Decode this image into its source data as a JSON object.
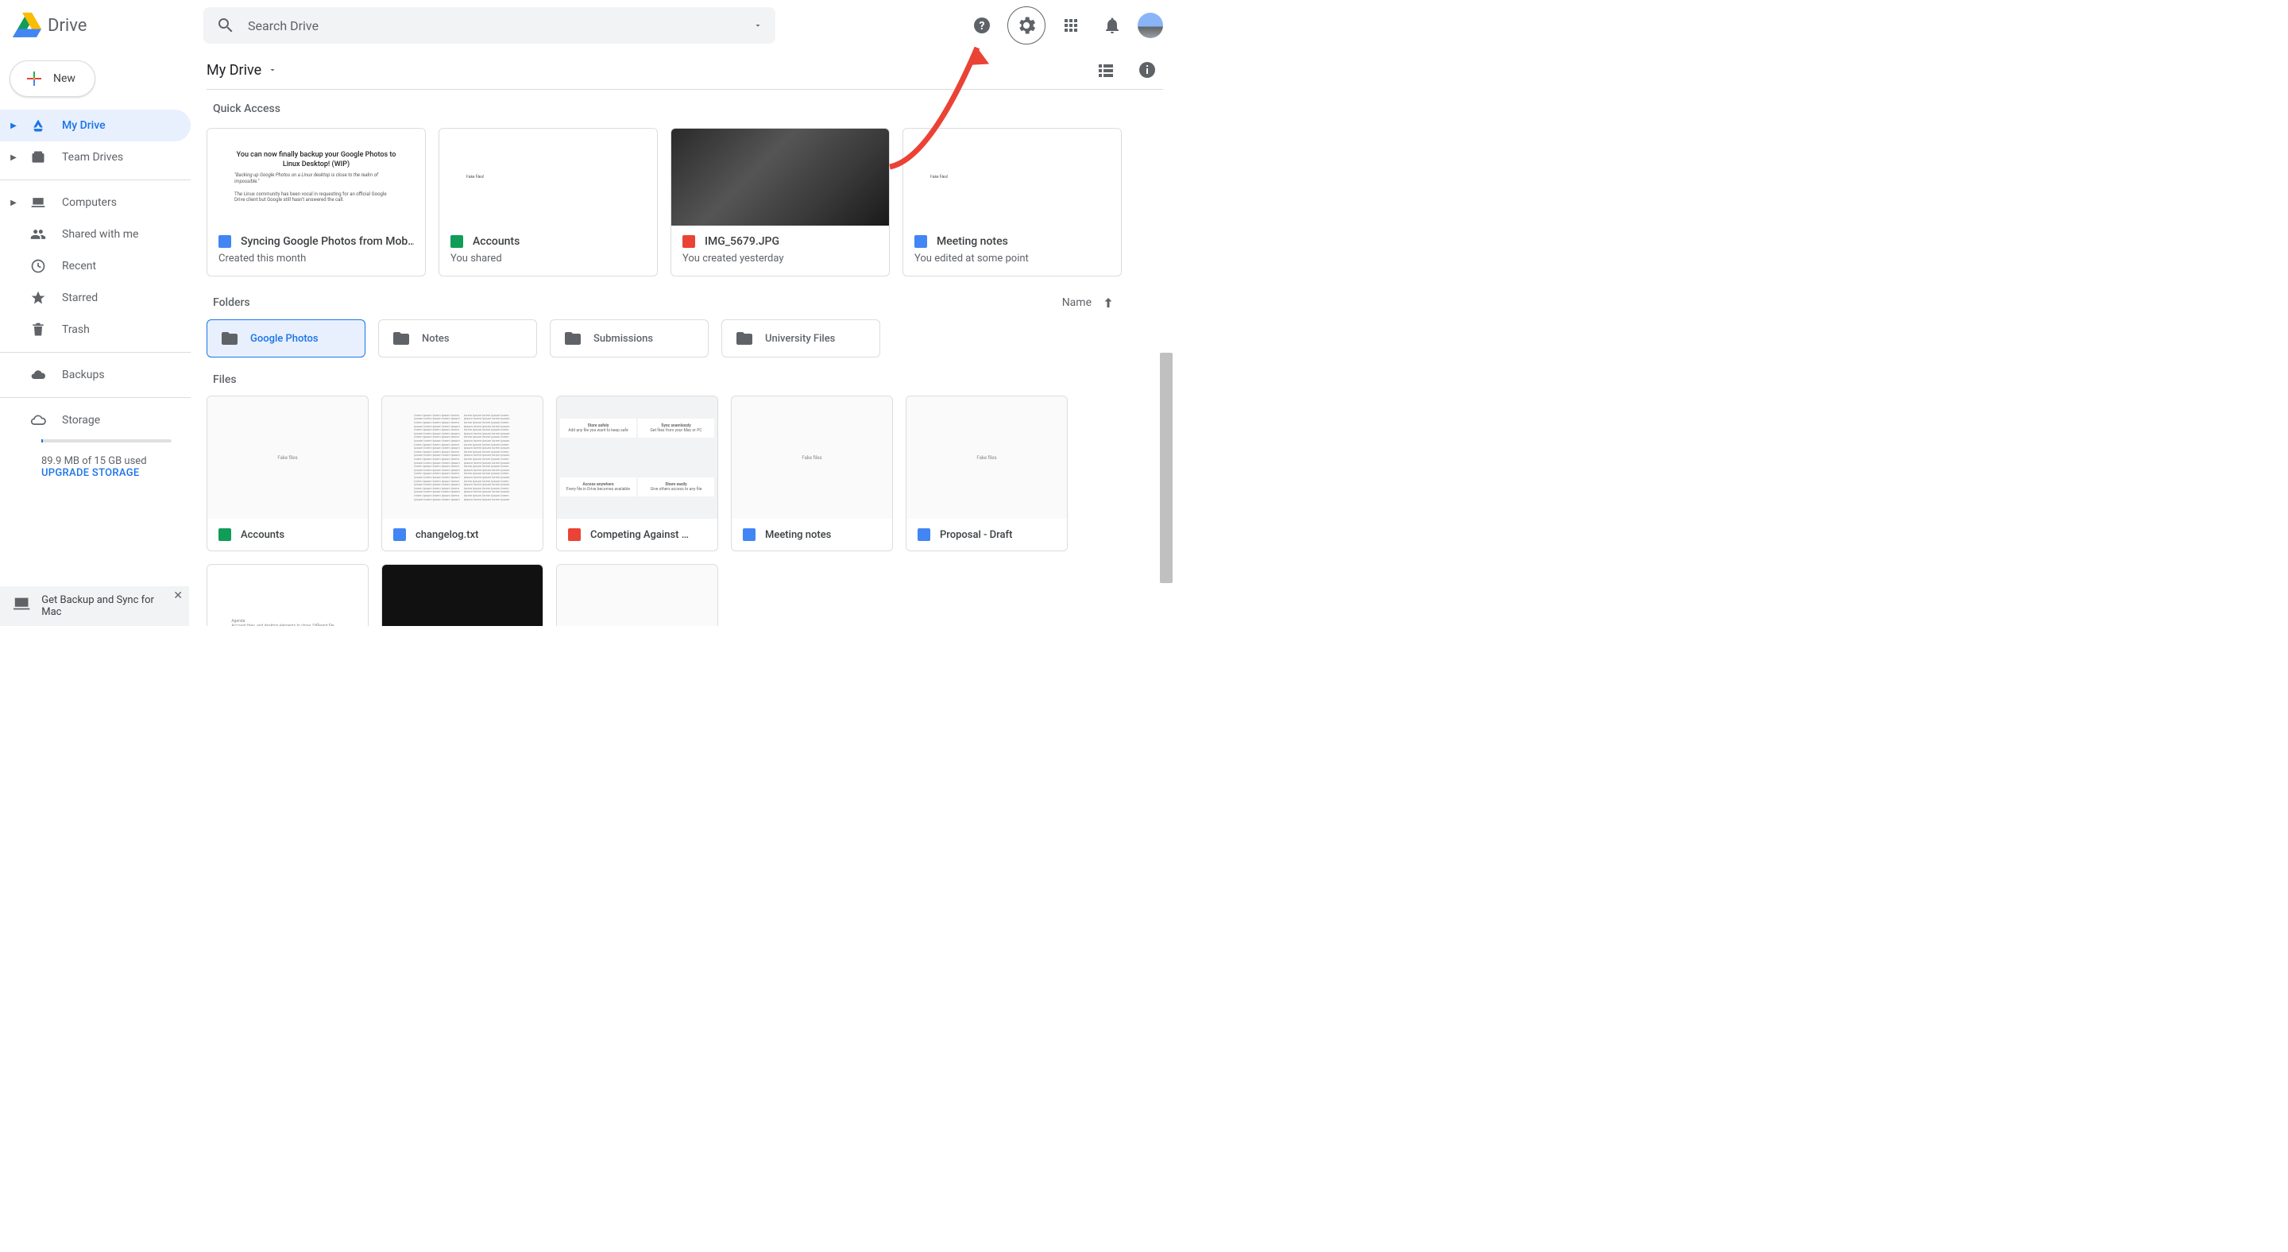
{
  "app": {
    "name": "Drive",
    "search_placeholder": "Search Drive"
  },
  "sidebar": {
    "new_label": "New",
    "items": [
      {
        "label": "My Drive",
        "active": true,
        "icon": "drive",
        "chev": true
      },
      {
        "label": "Team Drives",
        "active": false,
        "icon": "team",
        "chev": true
      }
    ],
    "items2": [
      {
        "label": "Computers",
        "icon": "laptop",
        "chev": true
      },
      {
        "label": "Shared with me",
        "icon": "people"
      },
      {
        "label": "Recent",
        "icon": "clock"
      },
      {
        "label": "Starred",
        "icon": "star"
      },
      {
        "label": "Trash",
        "icon": "trash"
      }
    ],
    "backups_label": "Backups",
    "storage_label": "Storage",
    "storage_used": "89.9 MB of 15 GB used",
    "upgrade_label": "UPGRADE STORAGE"
  },
  "breadcrumb": "My Drive",
  "quick_access": {
    "title": "Quick Access",
    "cards": [
      {
        "icon": "docs",
        "title": "Syncing Google Photos from Mob…",
        "sub": "Created this month",
        "thumb_title": "You can now finally backup your Google Photos to Linux Desktop! (WIP)"
      },
      {
        "icon": "sheets",
        "title": "Accounts",
        "sub": "You shared"
      },
      {
        "icon": "img",
        "title": "IMG_5679.JPG",
        "sub": "You created yesterday"
      },
      {
        "icon": "docs",
        "title": "Meeting notes",
        "sub": "You edited at some point"
      }
    ]
  },
  "folders": {
    "title": "Folders",
    "sort": "Name",
    "items": [
      {
        "label": "Google Photos",
        "selected": true
      },
      {
        "label": "Notes"
      },
      {
        "label": "Submissions"
      },
      {
        "label": "University Files"
      }
    ]
  },
  "files": {
    "title": "Files",
    "items": [
      {
        "icon": "sheets",
        "title": "Accounts"
      },
      {
        "icon": "docs",
        "title": "changelog.txt"
      },
      {
        "icon": "pdf",
        "title": "Competing Against …"
      },
      {
        "icon": "docs",
        "title": "Meeting notes"
      },
      {
        "icon": "docs",
        "title": "Proposal - Draft"
      }
    ]
  },
  "promo": {
    "text": "Get Backup and Sync for Mac"
  }
}
